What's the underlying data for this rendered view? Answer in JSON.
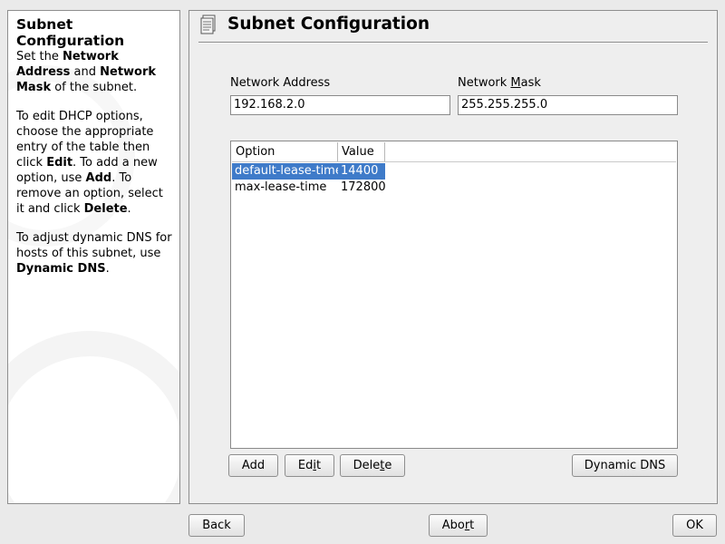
{
  "help": {
    "title": "Subnet Configuration",
    "p1": [
      "Set the ",
      "Network Address",
      " and ",
      "Network Mask",
      " of the subnet."
    ],
    "p2": [
      "To edit DHCP options, choose the appropriate entry of the table then click ",
      "Edit",
      ". To add a new option, use ",
      "Add",
      ". To remove an option, select it and click ",
      "Delete",
      "."
    ],
    "p3": [
      "To adjust dynamic DNS for hosts of this subnet, use ",
      "Dynamic DNS",
      "."
    ]
  },
  "main": {
    "title": "Subnet Configuration",
    "network_address": {
      "label": "Network Address",
      "value": "192.168.2.0"
    },
    "network_mask": {
      "label": "Network Mask",
      "value": "255.255.255.0"
    },
    "table": {
      "headers": [
        "Option",
        "Value"
      ],
      "rows": [
        {
          "option": "default-lease-time",
          "value": "14400",
          "selected": true
        },
        {
          "option": "max-lease-time",
          "value": "172800",
          "selected": false
        }
      ]
    },
    "buttons": {
      "add": "Add",
      "edit": "Edit",
      "delete": "Delete",
      "dynamic_dns": "Dynamic DNS"
    }
  },
  "footer": {
    "back": "Back",
    "abort": "Abort",
    "ok": "OK"
  },
  "colors": {
    "selection": "#3f7bc9"
  }
}
